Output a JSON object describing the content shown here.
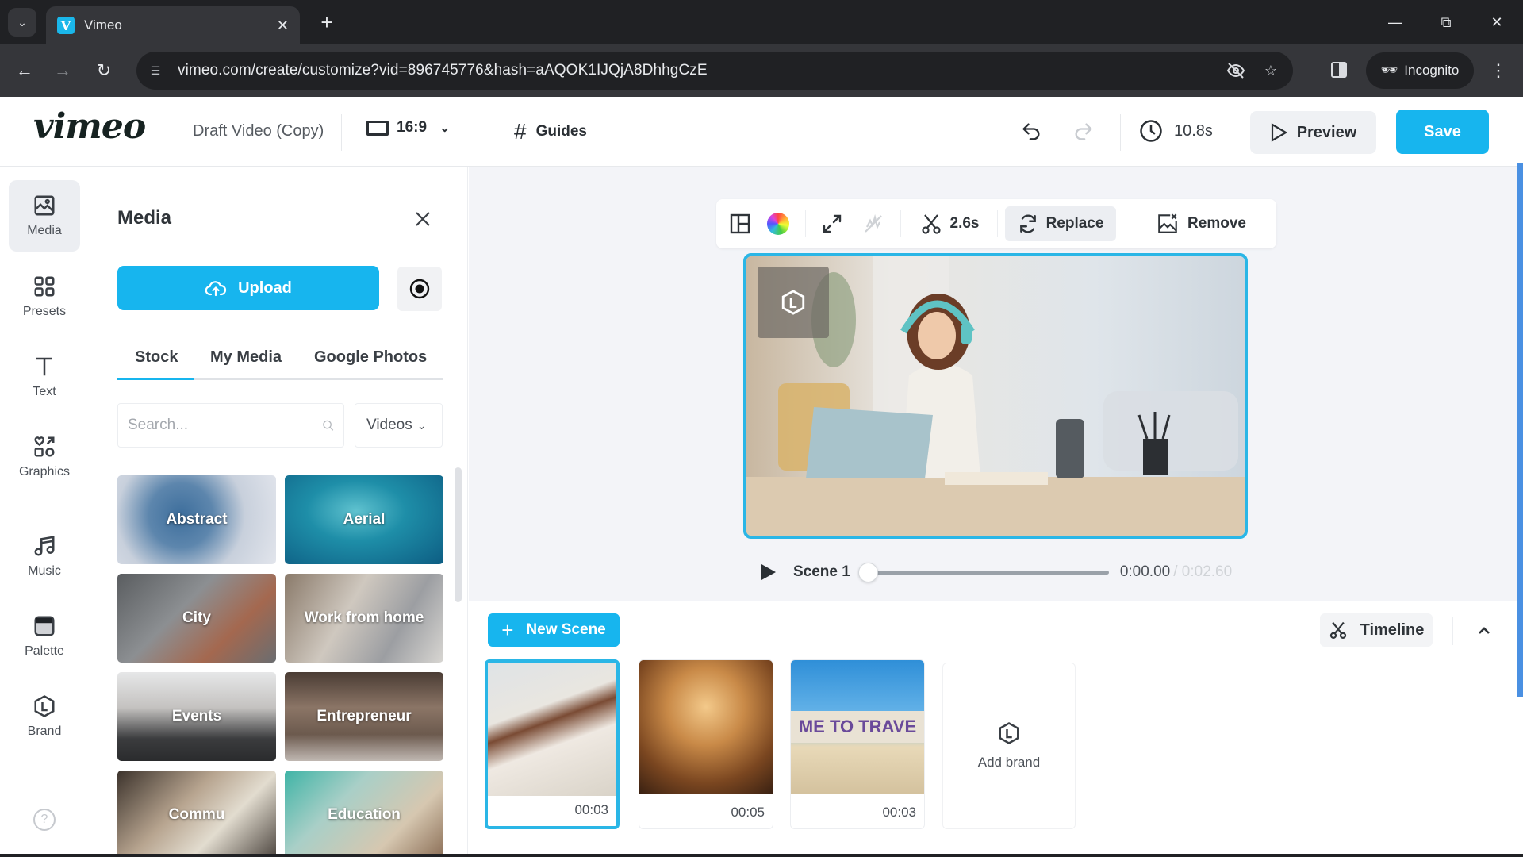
{
  "browser": {
    "tab_title": "Vimeo",
    "tab_favicon_letter": "V",
    "url": "vimeo.com/create/customize?vid=896745776&hash=aAQOK1IJQjA8DhhgCzE",
    "incognito_label": "Incognito"
  },
  "header": {
    "logo": "vimeo",
    "doc_title": "Draft Video (Copy)",
    "aspect_ratio": "16:9",
    "guides_label": "Guides",
    "duration": "10.8s",
    "preview_label": "Preview",
    "save_label": "Save"
  },
  "rail": {
    "items": [
      {
        "label": "Media",
        "icon": "image-icon",
        "active": true
      },
      {
        "label": "Presets",
        "icon": "grid-icon"
      },
      {
        "label": "Text",
        "icon": "text-icon"
      },
      {
        "label": "Graphics",
        "icon": "shapes-icon"
      },
      {
        "label": "Music",
        "icon": "music-note-icon"
      },
      {
        "label": "Palette",
        "icon": "palette-icon"
      },
      {
        "label": "Brand",
        "icon": "brand-hexagon-icon"
      }
    ],
    "help": "?"
  },
  "media_panel": {
    "title": "Media",
    "upload_label": "Upload",
    "tabs": [
      "Stock",
      "My Media",
      "Google Photos"
    ],
    "active_tab": "Stock",
    "search_placeholder": "Search...",
    "type_filter": "Videos",
    "categories": [
      "Abstract",
      "Aerial",
      "City",
      "Work from home",
      "Events",
      "Entrepreneur",
      "Commu",
      "Education"
    ]
  },
  "scene_toolbar": {
    "trim_duration": "2.6s",
    "replace_label": "Replace",
    "remove_label": "Remove"
  },
  "player": {
    "scene_label": "Scene 1",
    "current_time": "0:00.00",
    "total_time": "/ 0:02.60",
    "progress": 0
  },
  "scene_strip": {
    "new_scene_label": "New Scene",
    "timeline_label": "Timeline",
    "scenes": [
      {
        "duration": "00:03",
        "active": true
      },
      {
        "duration": "00:05"
      },
      {
        "duration": "00:03",
        "sign_text": "ME TO TRAVE"
      }
    ],
    "add_brand_label": "Add brand"
  },
  "colors": {
    "accent": "#17b5ee",
    "selection": "#2ab6e6"
  }
}
